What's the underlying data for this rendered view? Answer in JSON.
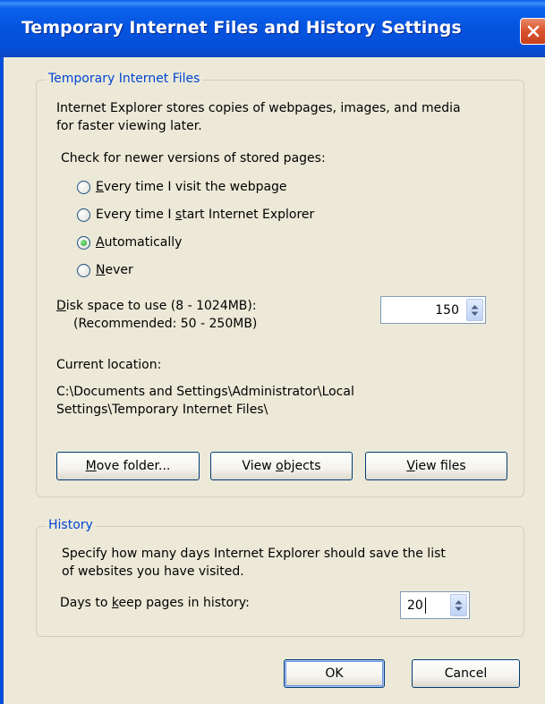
{
  "window": {
    "title": "Temporary Internet Files and History Settings"
  },
  "tif_group": {
    "legend": "Temporary Internet Files",
    "description_line1": "Internet Explorer stores copies of webpages, images, and media",
    "description_line2": "for faster viewing later.",
    "check_label": "Check for newer versions of stored pages:",
    "options": [
      {
        "pre": "",
        "key": "E",
        "post": "very time I visit the webpage",
        "selected": false
      },
      {
        "pre": "Every time I ",
        "key": "s",
        "post": "tart Internet Explorer",
        "selected": false
      },
      {
        "pre": "",
        "key": "A",
        "post": "utomatically",
        "selected": true
      },
      {
        "pre": "",
        "key": "N",
        "post": "ever",
        "selected": false
      }
    ],
    "disk_label_key": "D",
    "disk_label_rest": "isk space to use (8 - 1024MB):",
    "disk_recommended": "(Recommended: 50 - 250MB)",
    "disk_value": "150",
    "location_label": "Current location:",
    "location_line1": "C:\\Documents and Settings\\Administrator\\Local",
    "location_line2": "Settings\\Temporary Internet Files\\",
    "move_folder": {
      "key": "M",
      "rest": "ove folder..."
    },
    "view_objects": {
      "pre": "View ",
      "key": "o",
      "rest": "bjects"
    },
    "view_files": {
      "key": "V",
      "rest": "iew files"
    }
  },
  "history_group": {
    "legend": "History",
    "description_line1": "Specify how many days Internet Explorer should save the list",
    "description_line2": "of websites you have visited.",
    "days_label_pre": "Days to ",
    "days_label_key": "k",
    "days_label_post": "eep pages in history:",
    "days_value": "20"
  },
  "footer": {
    "ok_label": "OK",
    "cancel_label": "Cancel"
  }
}
